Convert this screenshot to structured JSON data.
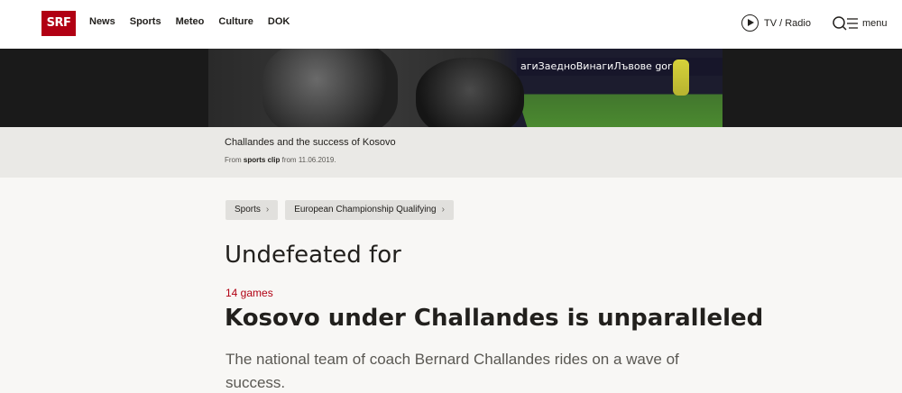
{
  "header": {
    "logo": "SRF",
    "nav": [
      "News",
      "Sports",
      "Meteo",
      "Culture",
      "DOK"
    ],
    "tv_radio": "TV / Radio",
    "menu": "menu"
  },
  "video": {
    "billboard_text": "агиЗаедноВинагиЛъвове gor"
  },
  "caption": {
    "title": "Challandes and the success of Kosovo",
    "from_prefix": "From",
    "source": "sports clip",
    "date_text": "from 11.06.2019."
  },
  "breadcrumb": [
    "Sports",
    "European Championship Qualifying"
  ],
  "article": {
    "kicker": "Undefeated for",
    "overline": "14 games",
    "headline": "Kosovo under Challandes is unparalleled",
    "lead": "The national team of coach Bernard Challandes rides on a wave of success."
  },
  "colors": {
    "brand": "#b10013",
    "background": "#f8f7f5"
  }
}
